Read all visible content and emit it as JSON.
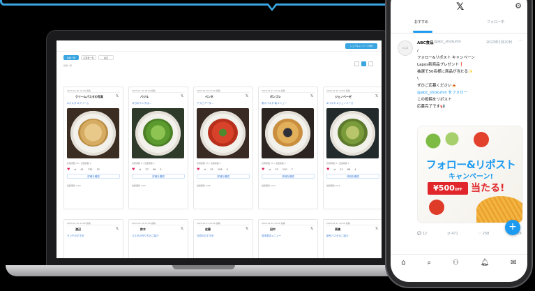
{
  "laptop": {
    "top_button": "シェアキャンペーン作成",
    "tabs": [
      "投稿一覧",
      "応募者一覧",
      "設定"
    ],
    "subtitle": "投稿一覧",
    "cards_row1": [
      {
        "header": "2023.01.20 12:00 投稿",
        "title": "クリームパスタの写真",
        "text": "#パスタ #クリーム",
        "meta": "応募者数 12 / 当選者数 3",
        "likes": "132",
        "reposts": "41",
        "replies": "12",
        "link": "詳細を確認",
        "foot": "最終更新 1/20"
      },
      {
        "header": "2023.01.19 18:30 投稿",
        "title": "バジル",
        "text": "今日のランチは…",
        "meta": "応募者数 8 / 当選者数 2",
        "likes": "98",
        "reposts": "27",
        "replies": "5",
        "link": "詳細を確認",
        "foot": "最終更新 1/19"
      },
      {
        "header": "2023.01.18 12:00 投稿",
        "title": "ペンネ",
        "text": "アラビアータ…",
        "meta": "応募者数 15 / 当選者数 4",
        "likes": "156",
        "reposts": "52",
        "replies": "9",
        "link": "詳細を確認",
        "foot": "最終更新 1/18"
      },
      {
        "header": "2023.01.17 12:00 投稿",
        "title": "ボンゴレ",
        "text": "魚介パスタ 新メニュー",
        "meta": "応募者数 10 / 当選者数 2",
        "likes": "120",
        "reposts": "33",
        "replies": "7",
        "link": "詳細を確認",
        "foot": "最終更新 1/17"
      },
      {
        "header": "2023.01.16 12:00 投稿",
        "title": "ジェノベーゼ",
        "text": "#パスタ #ジェノベーゼ",
        "meta": "応募者数 9 / 当選者数 2",
        "likes": "88",
        "reposts": "21",
        "replies": "4",
        "link": "詳細を確認",
        "foot": "最終更新 1/16"
      }
    ],
    "cards_row2": [
      {
        "header": "2023.01.15 12:00 投稿",
        "title": "渡辺",
        "text": "ランチのすすめ"
      },
      {
        "header": "2023.01.14 12:00 投稿",
        "title": "鈴木",
        "text": "パスタの作り方のご紹介"
      },
      {
        "header": "2023.01.13 12:00 投稿",
        "title": "佐藤",
        "text": "今週のおすすめ"
      },
      {
        "header": "2023.01.12 12:00 投稿",
        "title": "田中",
        "text": "週末限定メニュー"
      },
      {
        "header": "2023.01.11 12:00 投稿",
        "title": "高橋",
        "text": "新作パスタのご紹介"
      }
    ]
  },
  "phone": {
    "tab_active": "おすすめ",
    "tab_other": "フォロー中",
    "avatar_text": "ロゴ",
    "name": "ABC食品",
    "handle": "@abc_shokuhin",
    "time": "2023年1月20日",
    "body_lines": [
      "/",
      "フォロー&リポスト キャンペーン",
      "Lapos新商品プレゼント❗",
      "抽選で50名様に商品が当たる✨",
      "\\",
      "",
      "ぜひご応募ください🍝"
    ],
    "body_link_line": "@abc_shokuhin をフォロー",
    "body_tail_lines": [
      "この投稿をリポスト",
      "応募完了です📢"
    ],
    "promo": {
      "title": "フォロー&リポスト",
      "subtitle": "キャンペーン!",
      "badge_amount": "¥500",
      "badge_off": "OFF",
      "win_text": "当たる!"
    },
    "actions": [
      "12",
      "471",
      "258",
      "1.2K"
    ],
    "fab": "+"
  },
  "colors": {
    "accent": "#3aa5e0",
    "twitter_blue": "#1d9bf0",
    "like_red": "#e0245e",
    "promo_red": "#e0262b"
  }
}
